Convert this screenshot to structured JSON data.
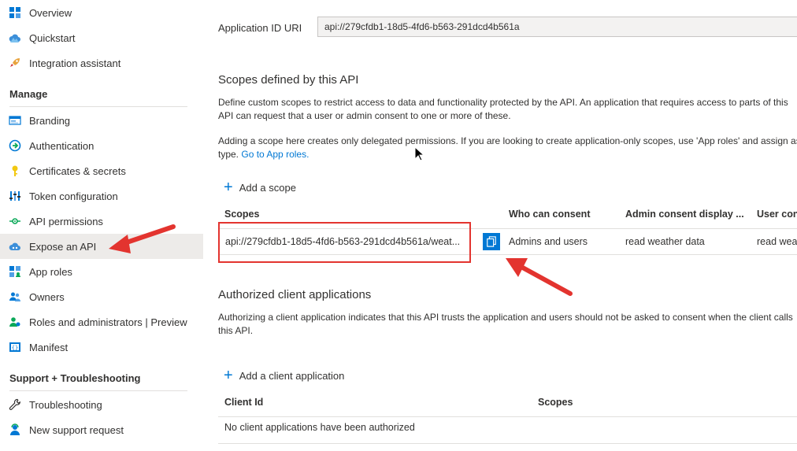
{
  "sidebar": {
    "top_items": [
      {
        "label": "Overview",
        "icon": "overview-grid-icon"
      },
      {
        "label": "Quickstart",
        "icon": "cloud-icon"
      },
      {
        "label": "Integration assistant",
        "icon": "rocket-icon"
      }
    ],
    "manage_header": "Manage",
    "manage_items": [
      {
        "label": "Branding",
        "icon": "branding-icon"
      },
      {
        "label": "Authentication",
        "icon": "authentication-icon"
      },
      {
        "label": "Certificates & secrets",
        "icon": "key-icon"
      },
      {
        "label": "Token configuration",
        "icon": "token-bars-icon"
      },
      {
        "label": "API permissions",
        "icon": "api-permissions-icon"
      },
      {
        "label": "Expose an API",
        "icon": "cloud-api-icon"
      },
      {
        "label": "App roles",
        "icon": "app-roles-icon"
      },
      {
        "label": "Owners",
        "icon": "owners-icon"
      },
      {
        "label": "Roles and administrators | Preview",
        "icon": "roles-admin-icon"
      },
      {
        "label": "Manifest",
        "icon": "manifest-icon"
      }
    ],
    "support_header": "Support + Troubleshooting",
    "support_items": [
      {
        "label": "Troubleshooting",
        "icon": "wrench-icon"
      },
      {
        "label": "New support request",
        "icon": "support-person-icon"
      }
    ],
    "selected": "Expose an API"
  },
  "main": {
    "app_id_uri_label": "Application ID URI",
    "app_id_uri_value": "api://279cfdb1-18d5-4fd6-b563-291dcd4b561a",
    "scopes_title": "Scopes defined by this API",
    "scopes_desc_line1": "Define custom scopes to restrict access to data and functionality protected by the API. An application that requires access to parts of this",
    "scopes_desc_line2": "API can request that a user or admin consent to one or more of these.",
    "scopes_note_line1": "Adding a scope here creates only delegated permissions. If you are looking to create application-only scopes, use 'App roles' and assign assignable",
    "scopes_note_line2_prefix": "type.",
    "go_to_app_roles_link": "Go to App roles.",
    "add_scope_label": "Add a scope",
    "scopes_table": {
      "headers": [
        "Scopes",
        "Who can consent",
        "Admin consent display ...",
        "User consent display name"
      ],
      "rows": [
        {
          "scope": "api://279cfdb1-18d5-4fd6-b563-291dcd4b561a/weat...",
          "who_can_consent": "Admins and users",
          "admin_consent_display": "read weather data",
          "user_consent_display": "read weather data"
        }
      ]
    },
    "authorized_title": "Authorized client applications",
    "authorized_desc_line1": "Authorizing a client application indicates that this API trusts the application and users should not be asked to consent when the client calls",
    "authorized_desc_line2": "this API.",
    "add_client_label": "Add a client application",
    "clients_table": {
      "headers": [
        "Client Id",
        "Scopes"
      ],
      "empty_message": "No client applications have been authorized"
    }
  },
  "colors": {
    "accent": "#0078d4",
    "annotation_red": "#e3342f",
    "selected_bg": "#edebe9"
  }
}
